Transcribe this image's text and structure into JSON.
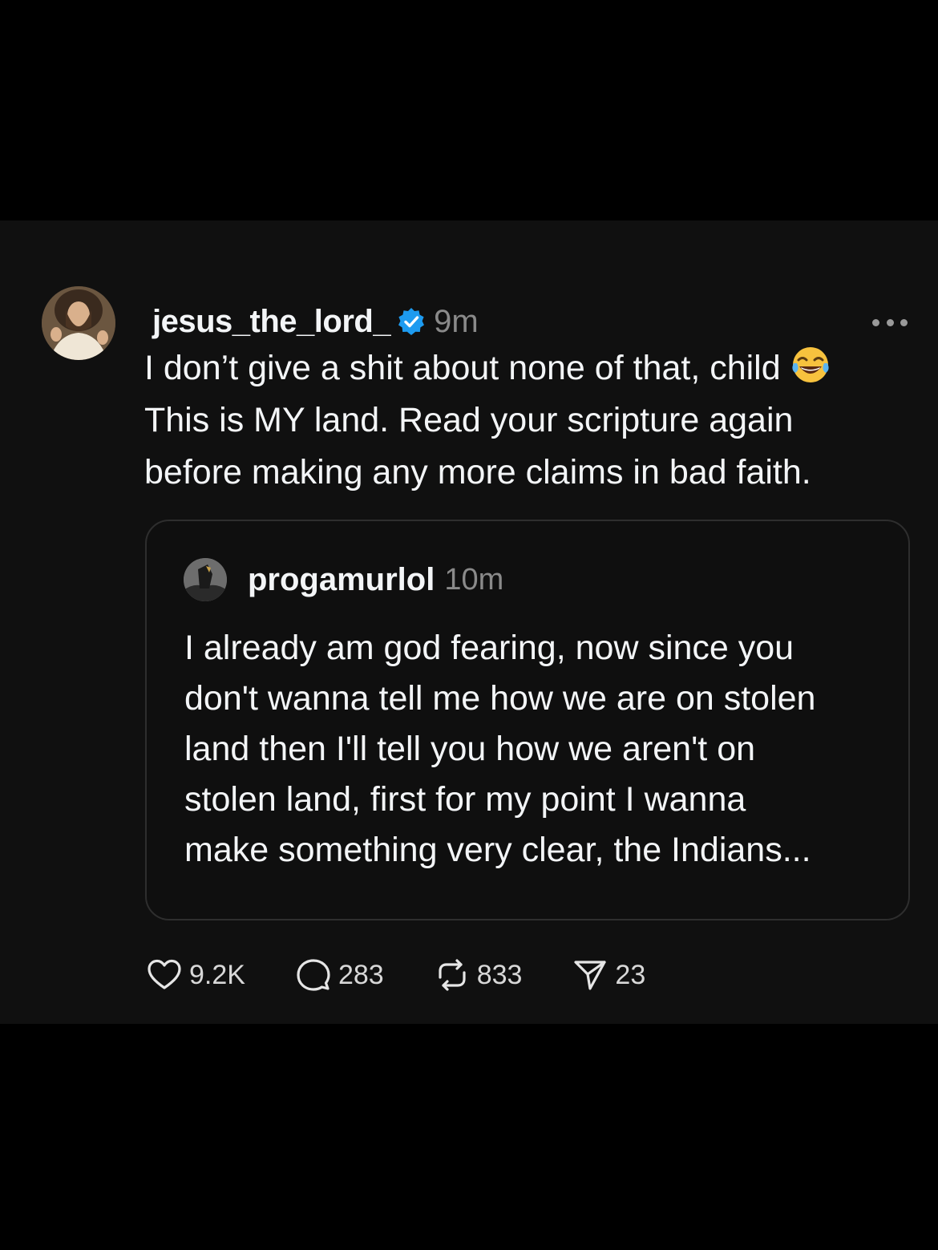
{
  "post": {
    "username": "jesus_the_lord_",
    "verified": true,
    "time": "9m",
    "more_icon": "more-horizontal-icon",
    "text_lines": [
      "I don’t give a shit about none of that, child",
      "This is MY land. Read your scripture again",
      "before making any more claims in bad faith."
    ],
    "emoji": "😂"
  },
  "quote": {
    "username": "progamurlol",
    "time": "10m",
    "text_lines": [
      "I already am god fearing, now since you",
      "don't wanna tell me how we are on stolen",
      "land then I'll tell you how we aren't on",
      "stolen land, first for my point I wanna",
      "make something very clear, the Indians..."
    ]
  },
  "actions": {
    "likes": "9.2K",
    "replies": "283",
    "reposts": "833",
    "shares": "23"
  },
  "colors": {
    "background": "#000000",
    "card": "#101010",
    "text": "#f3f5f7",
    "secondary": "#8a8a8a",
    "verified": "#1d9bf0"
  }
}
